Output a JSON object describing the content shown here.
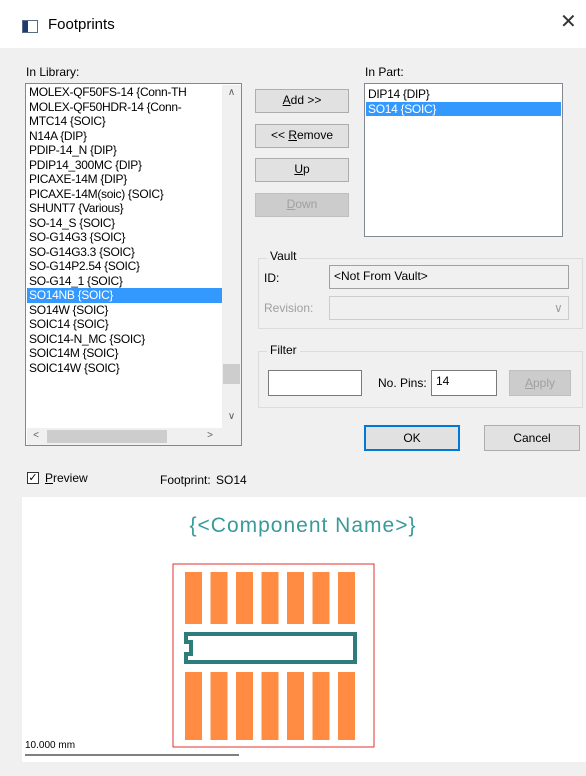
{
  "window": {
    "title": "Footprints",
    "close_glyph": "✕"
  },
  "labels": {
    "in_library": "In Library:",
    "in_part": "In Part:",
    "vault": "Vault",
    "id": "ID:",
    "revision": "Revision:",
    "filter": "Filter",
    "no_pins": "No. Pins:",
    "preview": "Preview",
    "footprint": "Footprint:",
    "footprint_value": "SO14"
  },
  "library_items": [
    "MOLEX-QF50FS-14 {Conn-TH",
    "MOLEX-QF50HDR-14 {Conn-",
    "MTC14 {SOIC}",
    "N14A {DIP}",
    "PDIP-14_N {DIP}",
    "PDIP14_300MC {DIP}",
    "PICAXE-14M {DIP}",
    "PICAXE-14M(soic) {SOIC}",
    "SHUNT7 {Various}",
    "SO-14_S {SOIC}",
    "SO-G14G3 {SOIC}",
    "SO-G14G3.3 {SOIC}",
    "SO-G14P2.54 {SOIC}",
    "SO-G14_1 {SOIC}",
    "SO14NB {SOIC}",
    "SO14W {SOIC}",
    "SOIC14 {SOIC}",
    "SOIC14-N_MC {SOIC}",
    "SOIC14M {SOIC}",
    "SOIC14W {SOIC}"
  ],
  "library_selected": "SO14NB {SOIC}",
  "part_items": [
    "DIP14 {DIP}",
    "SO14 {SOIC}"
  ],
  "part_selected": "SO14 {SOIC}",
  "buttons": {
    "add": "Add >>",
    "remove": "<< Remove",
    "up": "Up",
    "down": "Down",
    "apply": "Apply",
    "ok": "OK",
    "cancel": "Cancel"
  },
  "vault": {
    "id_value": "<Not From Vault>",
    "revision_value": ""
  },
  "filter": {
    "text_value": "",
    "pins_value": "14"
  },
  "preview_options": {
    "checked": true,
    "check_glyph": "✓"
  },
  "preview": {
    "component_name": "{<Component Name>}",
    "scale": "10.000 mm",
    "pads_per_row": 7,
    "colors": {
      "pad": "#ff8c42",
      "outline": "#e03030",
      "body": "#2e7d7d",
      "name": "#3a9a9a"
    }
  },
  "scroll_glyphs": {
    "up": "∧",
    "down": "∨",
    "left": "<",
    "right": ">",
    "combo": "∨"
  }
}
